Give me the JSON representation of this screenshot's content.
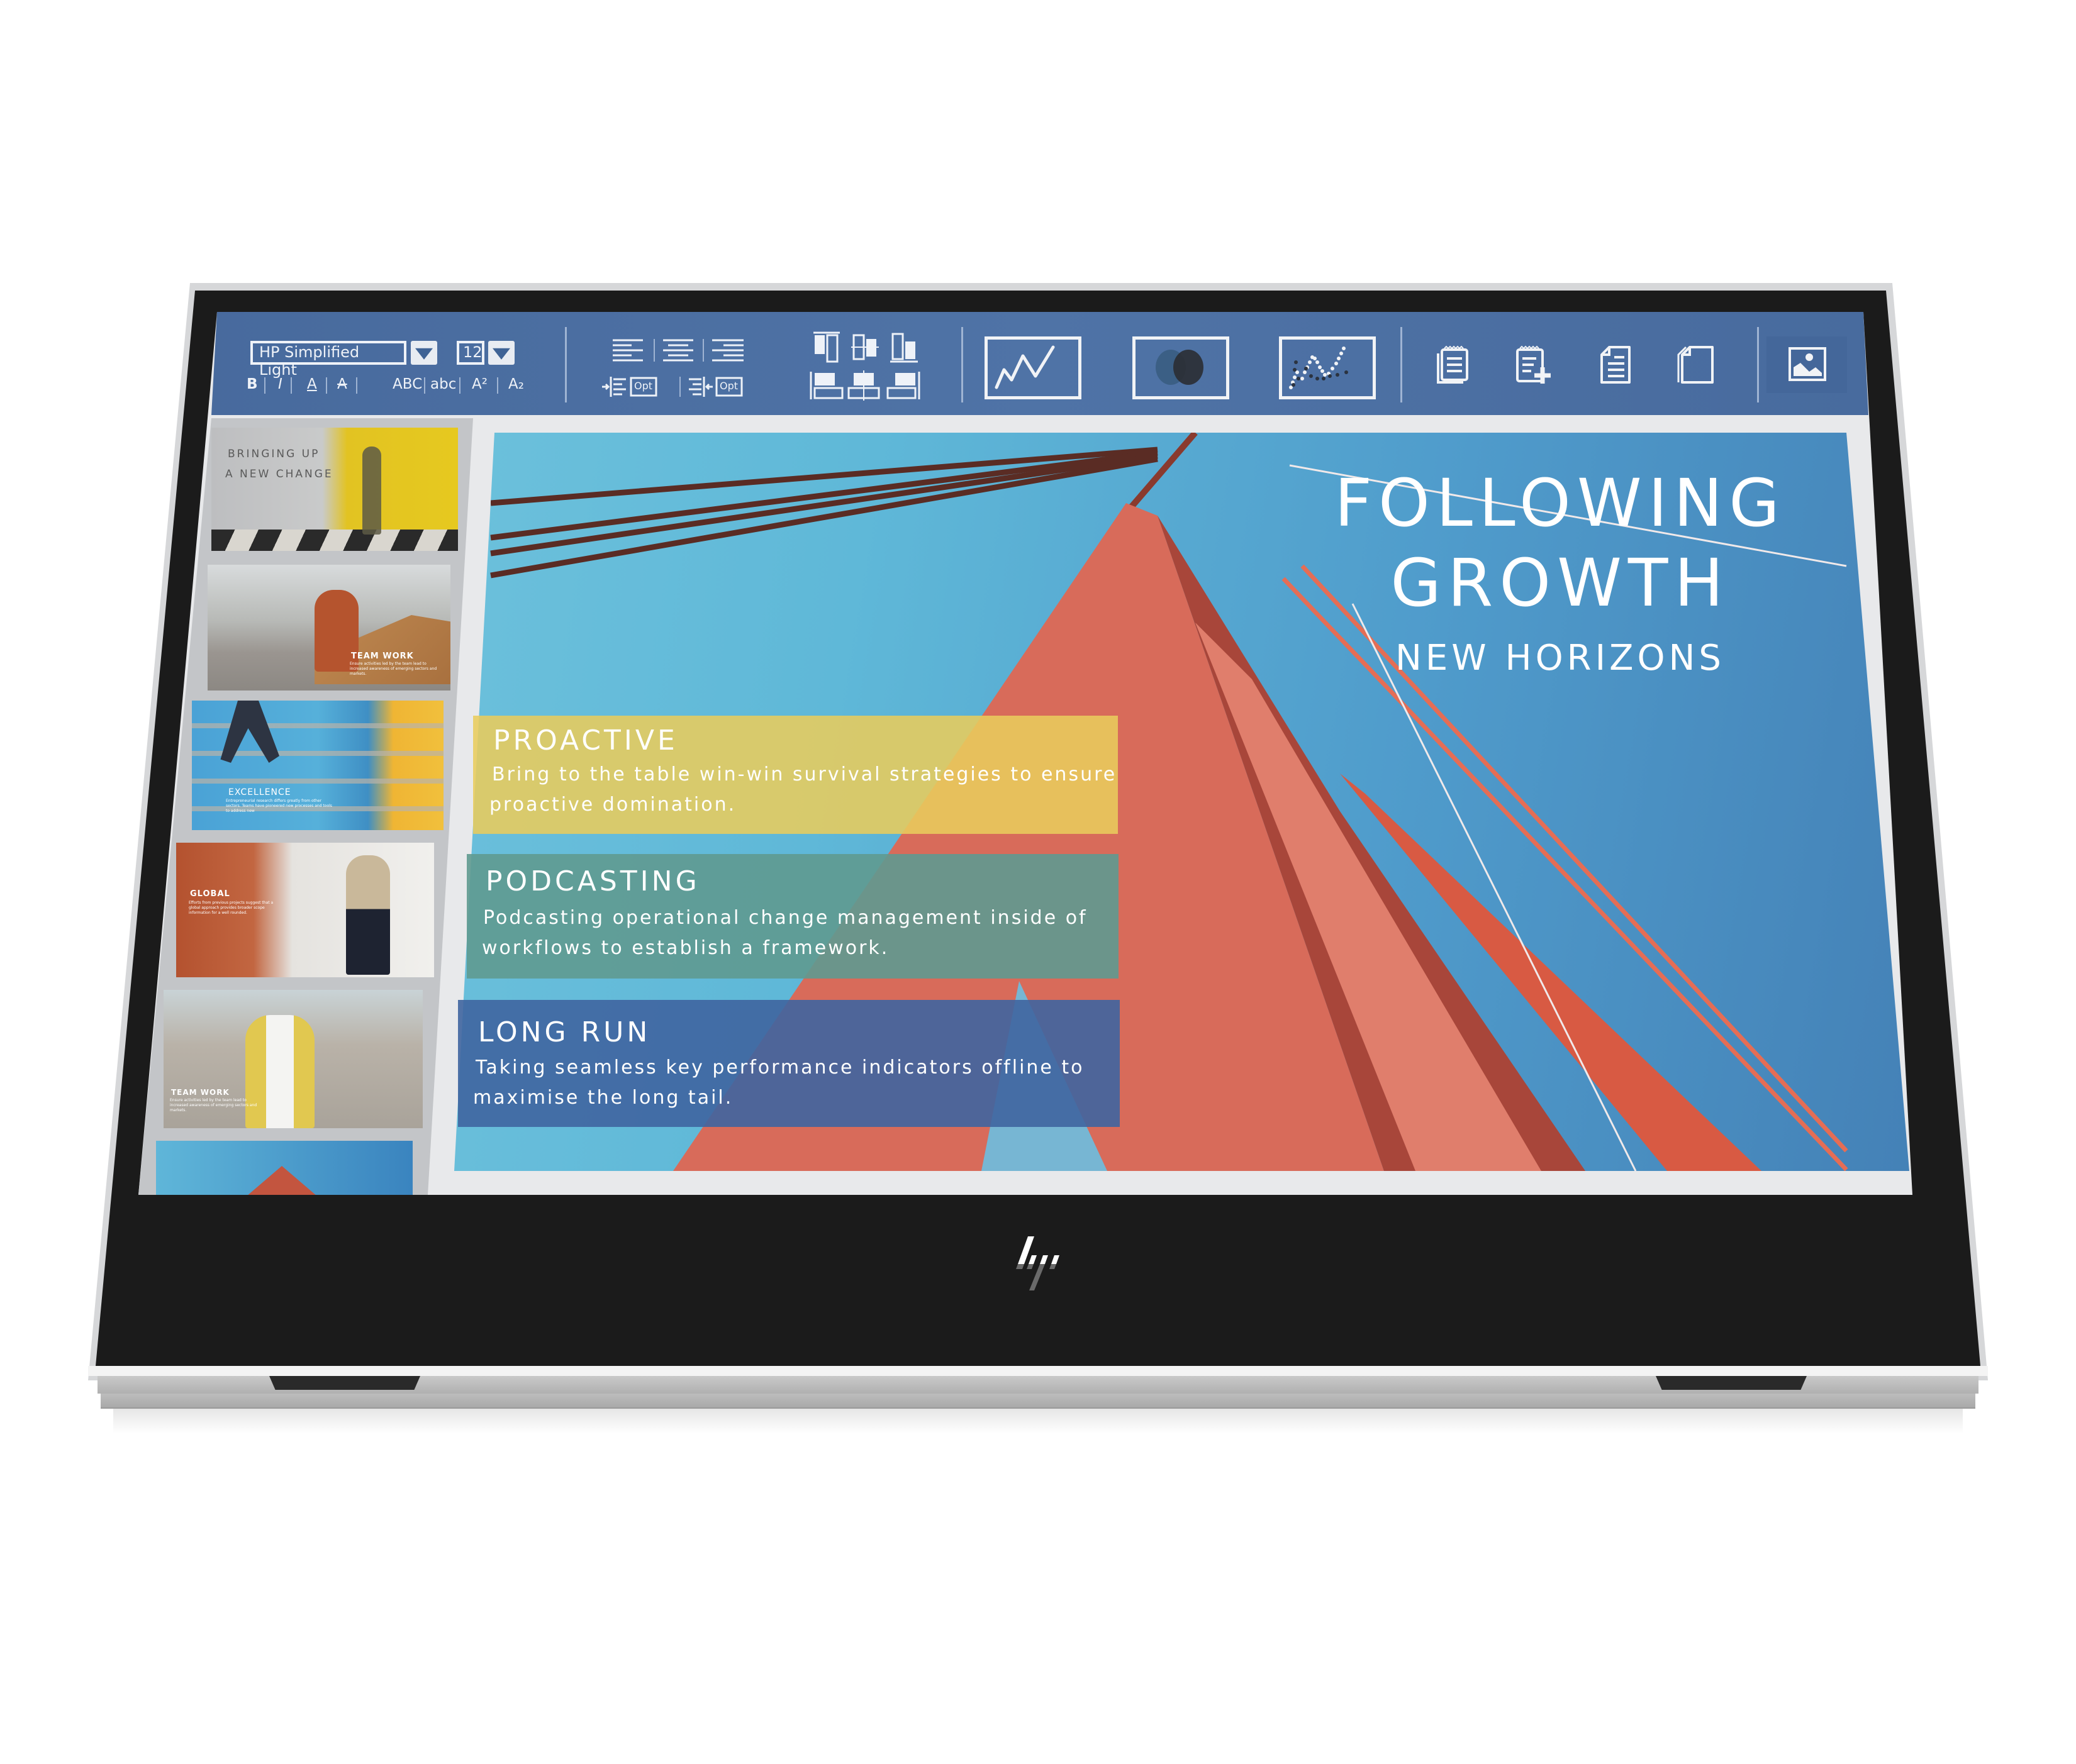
{
  "device": {
    "brand_logo": "hp-logo",
    "colors": {
      "bezel": "#1b1b1b",
      "frame": "#d6d7d9",
      "toolbar": "#4a6fa0",
      "side_panel": "#c3c5c8"
    }
  },
  "toolbar": {
    "font_family_value": "HP Simplified Light",
    "font_size_value": "12",
    "format_buttons": [
      {
        "name": "bold",
        "label": "B"
      },
      {
        "name": "italic",
        "label": "I"
      },
      {
        "name": "underline",
        "label": "A"
      },
      {
        "name": "strikethrough",
        "label": "A"
      }
    ],
    "case_buttons": [
      {
        "name": "uppercase",
        "label": "ABC"
      },
      {
        "name": "lowercase",
        "label": "abc"
      },
      {
        "name": "superscript",
        "label": "A²"
      },
      {
        "name": "subscript",
        "label": "A₂"
      }
    ],
    "paragraph": {
      "align_icons": [
        "align-left-icon",
        "align-center-icon",
        "align-right-icon"
      ],
      "indent_option_label": "Opt",
      "outdent_option_label": "Opt"
    },
    "arrange_icons": [
      "align-top-icon",
      "align-middle-icon",
      "align-bottom-icon",
      "align-left-objects-icon",
      "align-center-objects-icon",
      "align-right-objects-icon"
    ],
    "insert_icons": [
      "line-chart-icon",
      "venn-diagram-icon",
      "scatter-chart-icon"
    ],
    "document_icons": [
      "notes-icon",
      "add-note-icon",
      "document-icon",
      "copy-page-icon"
    ],
    "image_icon": "insert-image-icon"
  },
  "slides_panel": {
    "thumbnails": [
      {
        "title_line1": "BRINGING UP",
        "title_line2": "A NEW CHANGE",
        "body": ""
      },
      {
        "title": "TEAM WORK",
        "body": "Ensure activities led by the team lead to increased awareness of emerging sectors and markets."
      },
      {
        "title": "EXCELLENCE",
        "body": "Entrepreneurial research differs greatly from other sectors. Teams have pioneered new processes and tools to address new"
      },
      {
        "title": "GLOBAL",
        "body": "Efforts from previous projects suggest that a global approach provides broader scope information for a well rounded."
      },
      {
        "title": "TEAM WORK",
        "body": "Ensure activities led by the team lead to increased awareness of emerging sectors and markets."
      },
      {
        "title": "",
        "body": ""
      }
    ]
  },
  "main_slide": {
    "title_line1": "FOLLOWING",
    "title_line2": "GROWTH",
    "subtitle": "NEW HORIZONS",
    "sections": [
      {
        "title": "PROACTIVE",
        "body_line1": "Bring to the table win-win survival strategies to ensure",
        "body_line2": "proactive domination.",
        "color": "#e8cc5c"
      },
      {
        "title": "PODCASTING",
        "body_line1": "Podcasting operational change management inside of",
        "body_line2": "workflows to establish a framework.",
        "color": "#5f9a90"
      },
      {
        "title": "LONG RUN",
        "body_line1": "Taking seamless key performance indicators offline to",
        "body_line2": "maximise the long tail.",
        "color": "#3f65a0"
      }
    ]
  }
}
